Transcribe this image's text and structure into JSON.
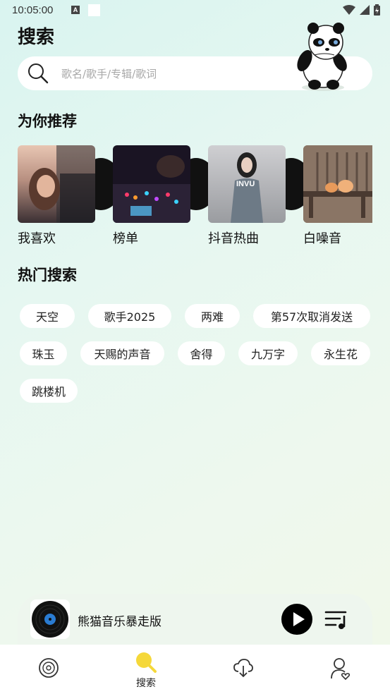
{
  "status_bar": {
    "time": "10:05:00",
    "notification_letter": "A"
  },
  "header": {
    "title": "搜索"
  },
  "search": {
    "placeholder": "歌名/歌手/专辑/歌词"
  },
  "recommend": {
    "title": "为你推荐",
    "items": [
      {
        "label": "我喜欢"
      },
      {
        "label": "榜单"
      },
      {
        "label": "抖音热曲",
        "cover_text": "INVU"
      },
      {
        "label": "白噪音"
      }
    ]
  },
  "hot_search": {
    "title": "热门搜索",
    "chips": [
      "天空",
      "歌手2025",
      "两难",
      "第57次取消发送",
      "珠玉",
      "天赐的声音",
      "舍得",
      "九万字",
      "永生花",
      "跳楼机"
    ]
  },
  "player": {
    "title": "熊猫音乐暴走版"
  },
  "tabs": [
    {
      "icon": "vinyl-icon",
      "label": ""
    },
    {
      "icon": "search-icon",
      "label": "搜索"
    },
    {
      "icon": "cloud-download-icon",
      "label": ""
    },
    {
      "icon": "user-heart-icon",
      "label": ""
    }
  ],
  "colors": {
    "active_tab": "#f5d83a",
    "accent_dark": "#000000"
  }
}
